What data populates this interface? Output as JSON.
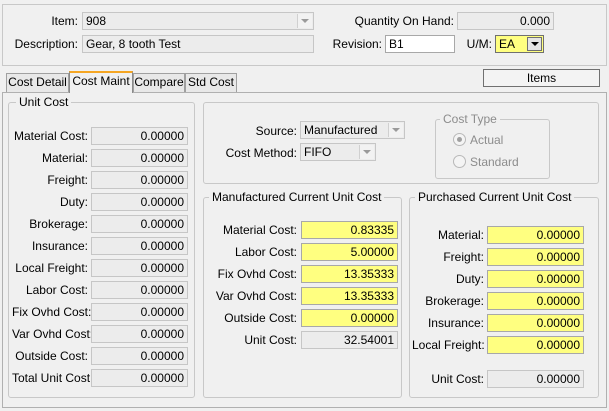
{
  "header": {
    "item_label": "Item:",
    "item_value": "908",
    "description_label": "Description:",
    "description_value": "Gear, 8 tooth Test",
    "qty_on_hand_label": "Quantity On Hand:",
    "qty_on_hand_value": "0.000",
    "revision_label": "Revision:",
    "revision_value": "B1",
    "um_label": "U/M:",
    "um_value": "EA"
  },
  "tabs": [
    {
      "label": "Cost Detail",
      "active": false
    },
    {
      "label": "Cost Maint",
      "active": true
    },
    {
      "label": "Compare",
      "active": false
    },
    {
      "label": "Std Cost",
      "active": false
    }
  ],
  "items_button": "Items",
  "unit_cost": {
    "title": "Unit Cost",
    "rows": [
      {
        "label": "Material Cost:",
        "value": "0.00000"
      },
      {
        "label": "Material:",
        "value": "0.00000"
      },
      {
        "label": "Freight:",
        "value": "0.00000"
      },
      {
        "label": "Duty:",
        "value": "0.00000"
      },
      {
        "label": "Brokerage:",
        "value": "0.00000"
      },
      {
        "label": "Insurance:",
        "value": "0.00000"
      },
      {
        "label": "Local Freight:",
        "value": "0.00000"
      },
      {
        "label": "Labor Cost:",
        "value": "0.00000"
      },
      {
        "label": "Fix Ovhd Cost:",
        "value": "0.00000"
      },
      {
        "label": "Var Ovhd Cost:",
        "value": "0.00000"
      },
      {
        "label": "Outside Cost:",
        "value": "0.00000"
      },
      {
        "label": "Total Unit Cost:",
        "value": "0.00000"
      }
    ]
  },
  "source": {
    "source_label": "Source:",
    "source_value": "Manufactured",
    "cost_method_label": "Cost Method:",
    "cost_method_value": "FIFO"
  },
  "cost_type": {
    "title": "Cost Type",
    "options": [
      {
        "label": "Actual",
        "checked": true
      },
      {
        "label": "Standard",
        "checked": false
      }
    ]
  },
  "manufactured": {
    "title": "Manufactured Current Unit Cost",
    "rows": [
      {
        "label": "Material Cost:",
        "value": "0.83335"
      },
      {
        "label": "Labor Cost:",
        "value": "5.00000"
      },
      {
        "label": "Fix Ovhd Cost:",
        "value": "13.35333"
      },
      {
        "label": "Var Ovhd Cost:",
        "value": "13.35333"
      },
      {
        "label": "Outside Cost:",
        "value": "0.00000"
      },
      {
        "label": "Unit Cost:",
        "value": "32.54001"
      }
    ]
  },
  "purchased": {
    "title": "Purchased Current Unit Cost",
    "rows": [
      {
        "label": "Material:",
        "value": "0.00000"
      },
      {
        "label": "Freight:",
        "value": "0.00000"
      },
      {
        "label": "Duty:",
        "value": "0.00000"
      },
      {
        "label": "Brokerage:",
        "value": "0.00000"
      },
      {
        "label": "Insurance:",
        "value": "0.00000"
      },
      {
        "label": "Local Freight:",
        "value": "0.00000"
      },
      {
        "label": "Unit Cost:",
        "value": "0.00000"
      }
    ]
  },
  "colors": {
    "editable_highlight": "#ffff80",
    "active_tab_accent": "#f5a623"
  }
}
